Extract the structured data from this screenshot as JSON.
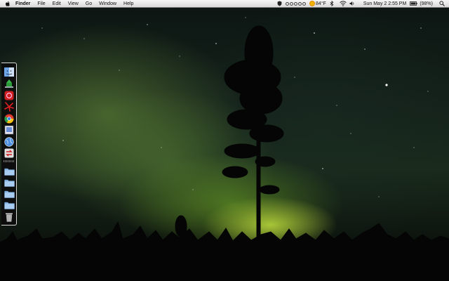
{
  "menubar": {
    "apple_icon": "apple-icon",
    "app_name": "Finder",
    "items": [
      "File",
      "Edit",
      "View",
      "Go",
      "Window",
      "Help"
    ],
    "status": {
      "temperature": "84°F",
      "battery": "(98%)",
      "clock": "Sun May 2  2:55 PM"
    }
  },
  "dock": {
    "items": [
      {
        "name": "finder-icon"
      },
      {
        "name": "green-app-icon"
      },
      {
        "name": "red-app-icon"
      },
      {
        "name": "red-fan-app-icon"
      },
      {
        "name": "chrome-icon"
      },
      {
        "name": "preview-icon"
      },
      {
        "name": "globe-app-icon"
      },
      {
        "name": "sync-app-icon"
      },
      {
        "name": "folder-icon"
      },
      {
        "name": "folder-icon"
      },
      {
        "name": "folder-icon"
      },
      {
        "name": "folder-icon"
      },
      {
        "name": "trash-icon"
      }
    ]
  },
  "colors": {
    "menubar_bg": "#e6e6e6",
    "aurora_green": "#9cc43a",
    "dock_bg": "#0c0c0c"
  }
}
